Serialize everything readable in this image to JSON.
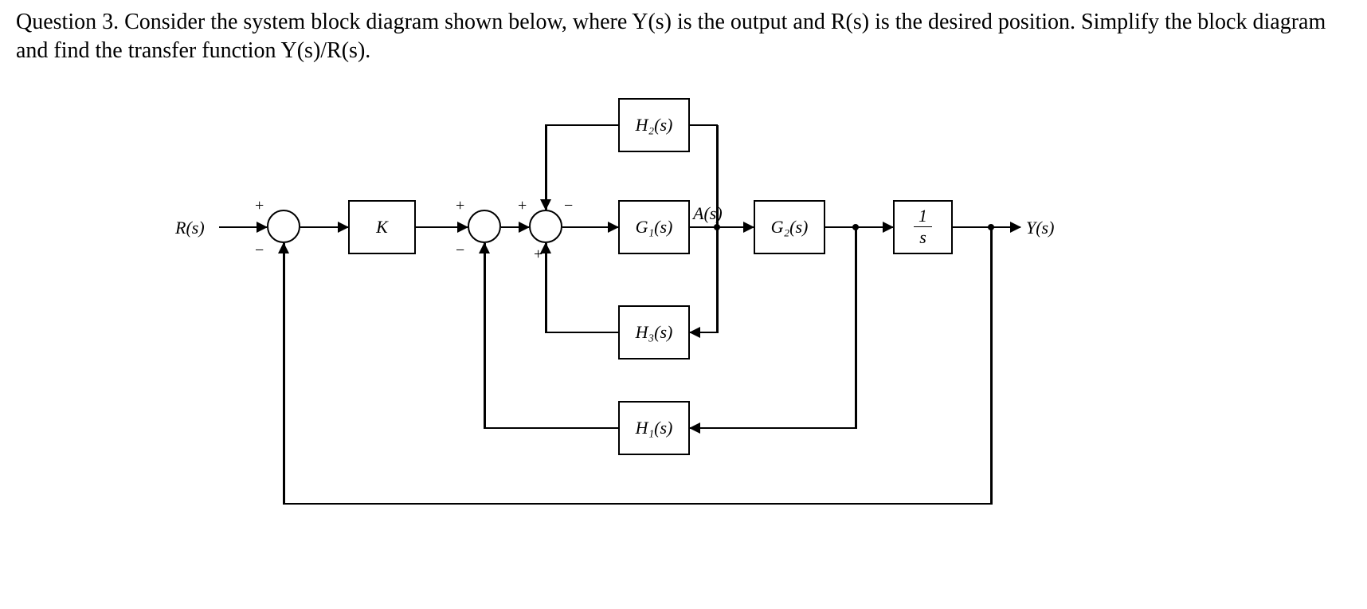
{
  "question": {
    "text": "Question 3. Consider the system block diagram shown below, where Y(s) is the output and R(s) is the desired position. Simplify the block diagram and find the transfer function Y(s)/R(s)."
  },
  "signals": {
    "input": "R(s)",
    "output": "Y(s)",
    "intermediate": "A(s)"
  },
  "blocks": {
    "K": "K",
    "G1": "G₁(s)",
    "G2": "G₂(s)",
    "integrator_num": "1",
    "integrator_den": "s",
    "H1": "H₁(s)",
    "H2": "H₂(s)",
    "H3": "H₃(s)"
  },
  "summing_junctions": {
    "s1": {
      "top": "+",
      "bottom": "−"
    },
    "s2": {
      "top": "+",
      "bottom": "−"
    },
    "s3": {
      "top_left": "+",
      "top_right": "−",
      "bottom": "+"
    }
  },
  "diagram_semantics": {
    "forward_path": [
      "K",
      "G1",
      "G2",
      "1/s"
    ],
    "feedback_paths": [
      {
        "from": "A(s) (output of G1)",
        "through": "H2",
        "to": "sum3",
        "sign": "−"
      },
      {
        "from": "A(s) (output of G1)",
        "through": "H3",
        "to": "sum3",
        "sign": "+"
      },
      {
        "from": "output of G2",
        "through": "H1",
        "to": "sum2",
        "sign": "−"
      },
      {
        "from": "Y(s)",
        "through": "unity",
        "to": "sum1",
        "sign": "−"
      }
    ]
  }
}
